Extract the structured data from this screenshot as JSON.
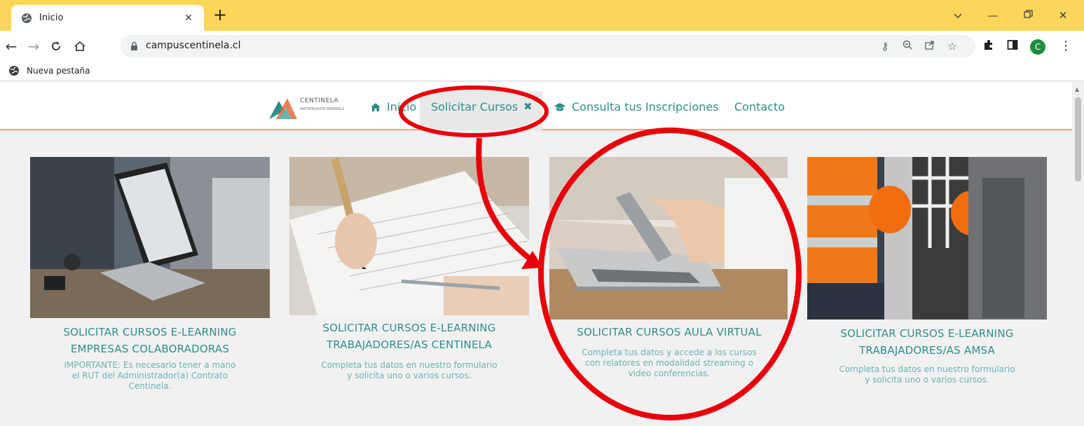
{
  "browser": {
    "tab_title": "Inicio",
    "url": "campuscentinela.cl",
    "bookmark_label": "Nueva pestaña",
    "profile_initial": "C",
    "tab_color": "#fcd65a"
  },
  "site": {
    "logo_text": "CENTINELA",
    "logo_subtext": "ANTOFAGASTA MINERALS",
    "nav": {
      "inicio": "Inicio",
      "solicitar": "Solicitar Cursos",
      "consulta": "Consulta tus Inscripciones",
      "contacto": "Contacto"
    },
    "accent_color": "#2f8e8c",
    "nav_underline_color": "#f3a18a"
  },
  "cards": [
    {
      "title_line1": "SOLICITAR CURSOS E-LEARNING",
      "title_line2": "EMPRESAS COLABORADORAS",
      "desc": [
        "IMPORTANTE: Es necesario tener a mano",
        "el RUT del Administrador(a) Contrato",
        "Centinela."
      ]
    },
    {
      "title_line1": "SOLICITAR CURSOS E-LEARNING",
      "title_line2": "TRABAJADORES/AS CENTINELA",
      "desc": [
        "Completa tus datos en nuestro formulario",
        "y solicita uno o varios cursos."
      ]
    },
    {
      "title_line1": "SOLICITAR CURSOS AULA VIRTUAL",
      "desc": [
        "Completa tus datos y accede a los cursos",
        "con relatores en modalidad streaming o",
        "video conferencias."
      ]
    },
    {
      "title_line1": "SOLICITAR CURSOS E-LEARNING",
      "title_line2": "TRABAJADORES/AS AMSA",
      "desc": [
        "Completa tus datos en nuestro formulario",
        "y solicita uno o varios cursos."
      ]
    }
  ],
  "annotation_color": "#e8000b"
}
